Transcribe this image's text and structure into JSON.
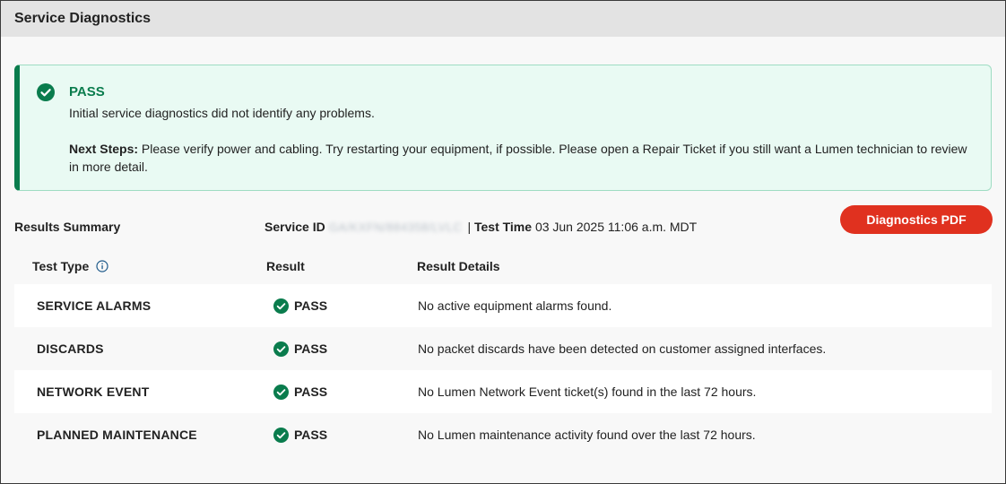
{
  "header": {
    "title": "Service Diagnostics"
  },
  "alert": {
    "status": "PASS",
    "message": "Initial service diagnostics did not identify any problems.",
    "next_steps_label": "Next Steps:",
    "next_steps_text": " Please verify power and cabling. Try restarting your equipment, if possible. Please open a Repair Ticket if you still want a Lumen technician to review in more detail.",
    "icon": "check-circle-icon",
    "accent_color": "#0a7c4d"
  },
  "summary": {
    "label": "Results Summary",
    "service_id_label": "Service ID",
    "service_id_value": "GA/KXFN/884358/LVLC",
    "separator": "|",
    "test_time_label": "Test Time",
    "test_time_value": "03 Jun 2025 11:06 a.m. MDT"
  },
  "pdf_button": {
    "label": "Diagnostics PDF",
    "color": "#e0311f"
  },
  "table": {
    "headers": {
      "test_type": "Test Type",
      "result": "Result",
      "details": "Result Details"
    },
    "rows": [
      {
        "test_type": "SERVICE ALARMS",
        "result": "PASS",
        "details": "No active equipment alarms found."
      },
      {
        "test_type": "DISCARDS",
        "result": "PASS",
        "details": "No packet discards have been detected on customer assigned interfaces."
      },
      {
        "test_type": "NETWORK EVENT",
        "result": "PASS",
        "details": "No Lumen Network Event ticket(s) found in the last 72 hours."
      },
      {
        "test_type": "PLANNED MAINTENANCE",
        "result": "PASS",
        "details": "No Lumen maintenance activity found over the last 72 hours."
      }
    ]
  }
}
